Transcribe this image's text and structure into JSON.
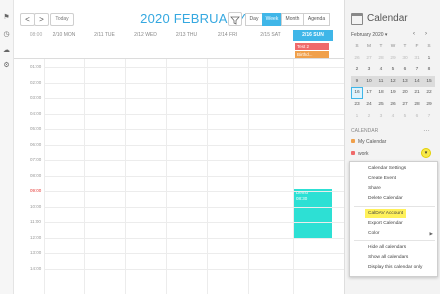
{
  "rail": {
    "icons": [
      "bookmark-icon",
      "clock-icon",
      "cloud-icon",
      "settings-icon"
    ]
  },
  "toolbar": {
    "prev_label": "<",
    "next_label": ">",
    "today_label": "Today",
    "title": "2020 FEBRUARY",
    "filter_icon": "funnel-icon",
    "views": [
      {
        "label": "Day",
        "active": false
      },
      {
        "label": "Week",
        "active": true
      },
      {
        "label": "Month",
        "active": false
      },
      {
        "label": "Agenda",
        "active": false
      }
    ]
  },
  "week": {
    "tz_label": "08:00",
    "days": [
      {
        "label": "2/10 MON",
        "today": false
      },
      {
        "label": "2/11 TUE",
        "today": false
      },
      {
        "label": "2/12 WED",
        "today": false
      },
      {
        "label": "2/13 THU",
        "today": false
      },
      {
        "label": "2/14 FRI",
        "today": false
      },
      {
        "label": "2/15 SAT",
        "today": false
      },
      {
        "label": "2/16 SUN",
        "today": true
      }
    ],
    "allday_events": [
      {
        "label": "Test 2",
        "color": "#f06a6a"
      },
      {
        "label": "Birthd...",
        "color": "#f0a04b"
      }
    ],
    "hours": [
      "01:00",
      "02:00",
      "03:00",
      "04:00",
      "05:00",
      "06:00",
      "07:00",
      "08:00",
      "09:00",
      "10:00",
      "11:00",
      "12:00",
      "13:00",
      "14:00"
    ],
    "now_label": "09:00",
    "event": {
      "title": "Demo",
      "time": "08:30",
      "color": "#2de0d4"
    }
  },
  "panel": {
    "title": "Calendar",
    "month_label": "February 2020 ▾",
    "mini_nav": {
      "prev": "‹",
      "next": "›"
    },
    "weekday_heads": [
      "S",
      "M",
      "T",
      "W",
      "T",
      "F",
      "S"
    ],
    "weeks": [
      [
        "26",
        "27",
        "28",
        "29",
        "30",
        "31",
        "1"
      ],
      [
        "2",
        "3",
        "4",
        "5",
        "6",
        "7",
        "8"
      ],
      [
        "9",
        "10",
        "11",
        "12",
        "13",
        "14",
        "15"
      ],
      [
        "16",
        "17",
        "18",
        "19",
        "20",
        "21",
        "22"
      ],
      [
        "23",
        "24",
        "25",
        "26",
        "27",
        "28",
        "29"
      ],
      [
        "1",
        "2",
        "3",
        "4",
        "5",
        "6",
        "7"
      ]
    ],
    "section_label": "CALENDAR",
    "more_label": "…",
    "calendars": [
      {
        "name": "My Calendar",
        "color": "#f0a04b"
      },
      {
        "name": "work",
        "color": "#f06a6a"
      }
    ],
    "menu_btn_label": "▾"
  },
  "menu": {
    "items": [
      {
        "label": "Calendar Settings"
      },
      {
        "label": "Create Event"
      },
      {
        "label": "Share"
      },
      {
        "label": "Delete Calendar"
      },
      {
        "label": "CalDAV Account",
        "highlight": true
      },
      {
        "label": "Export Calendar"
      },
      {
        "label": "Color",
        "submenu": true
      },
      {
        "label": "Hide all calendars"
      },
      {
        "label": "Show all calendars"
      },
      {
        "label": "Display this calendar only"
      }
    ],
    "arrow": "▶"
  }
}
